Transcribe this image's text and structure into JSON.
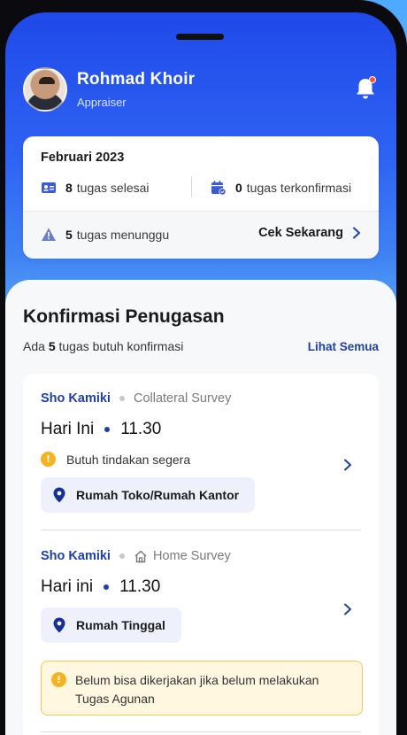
{
  "user": {
    "name": "Rohmad Khoir",
    "role": "Appraiser"
  },
  "summary": {
    "month": "Februari 2023",
    "done_count": "8",
    "done_label": "tugas selesai",
    "confirmed_count": "0",
    "confirmed_label": "tugas terkonfirmasi",
    "waiting_count": "5",
    "waiting_label": "tugas menunggu",
    "check_now": "Cek Sekarang"
  },
  "section": {
    "title": "Konfirmasi Penugasan",
    "sub_prefix": "Ada",
    "sub_count": "5",
    "sub_suffix": "tugas butuh konfirmasi",
    "see_all": "Lihat Semua"
  },
  "tasks": [
    {
      "client": "Sho Kamiki",
      "type": "Collateral Survey",
      "day": "Hari Ini",
      "time": "11.30",
      "alert": "Butuh tindakan segera",
      "location": "Rumah Toko/Rumah Kantor"
    },
    {
      "client": "Sho Kamiki",
      "type": "Home Survey",
      "day": "Hari ini",
      "time": "11.30",
      "location": "Rumah Tinggal",
      "notice": "Belum bisa dikerjakan jika belum melakukan Tugas Agunan"
    }
  ],
  "colors": {
    "primary": "#1f3fa8",
    "header_blue": "#2a5bf0",
    "warning": "#f6b31f",
    "notification_dot": "#ff4d3a"
  }
}
